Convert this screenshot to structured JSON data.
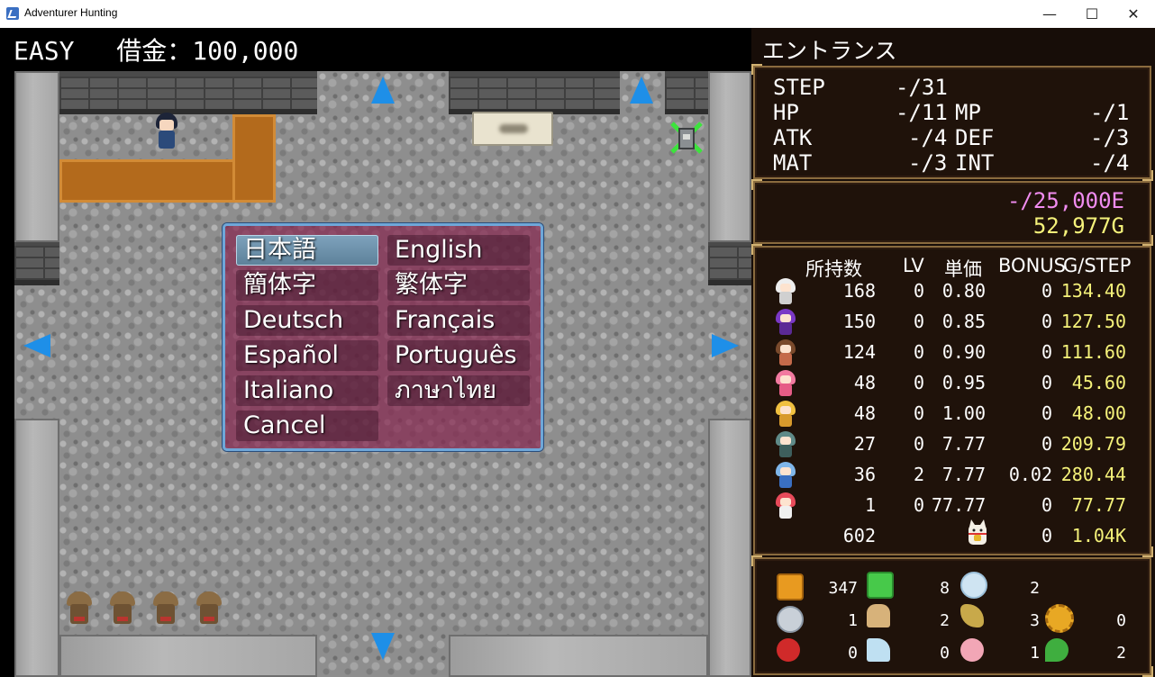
{
  "window": {
    "title": "Adventurer Hunting",
    "minimize": "—",
    "maximize": "☐",
    "close": "✕"
  },
  "hud": {
    "difficulty": "EASY",
    "debt": "借金：100,000"
  },
  "language_menu": {
    "options": [
      "日本語",
      "English",
      "簡体字",
      "繁体字",
      "Deutsch",
      "Français",
      "Español",
      "Português",
      "Italiano",
      "ภาษาไทย",
      "Cancel"
    ],
    "selected": "日本語"
  },
  "panel": {
    "location": "エントランス",
    "stats": [
      {
        "label": "STEP",
        "value": "-/31"
      },
      {
        "label": "HP",
        "value": "-/11"
      },
      {
        "label": "MP",
        "value": "-/1"
      },
      {
        "label": "ATK",
        "value": "-/4"
      },
      {
        "label": "DEF",
        "value": "-/3"
      },
      {
        "label": "MAT",
        "value": "-/3"
      },
      {
        "label": "INT",
        "value": "-/4"
      }
    ],
    "exp": "-/25,000E",
    "gold": "52,977G",
    "table_headers": [
      "所持数",
      "LV",
      "単価",
      "BONUS",
      "G/STEP"
    ],
    "rows": [
      {
        "owned": "168",
        "lv": "0",
        "price": "0.80",
        "bonus": "0",
        "gstep": "134.40"
      },
      {
        "owned": "150",
        "lv": "0",
        "price": "0.85",
        "bonus": "0",
        "gstep": "127.50"
      },
      {
        "owned": "124",
        "lv": "0",
        "price": "0.90",
        "bonus": "0",
        "gstep": "111.60"
      },
      {
        "owned": "48",
        "lv": "0",
        "price": "0.95",
        "bonus": "0",
        "gstep": "45.60"
      },
      {
        "owned": "48",
        "lv": "0",
        "price": "1.00",
        "bonus": "0",
        "gstep": "48.00"
      },
      {
        "owned": "27",
        "lv": "0",
        "price": "7.77",
        "bonus": "0",
        "gstep": "209.79"
      },
      {
        "owned": "36",
        "lv": "2",
        "price": "7.77",
        "bonus": "0.02",
        "gstep": "280.44"
      },
      {
        "owned": "1",
        "lv": "0",
        "price": "77.77",
        "bonus": "0",
        "gstep": "77.77"
      }
    ],
    "totals": {
      "owned": "602",
      "bonus": "0",
      "gstep": "1.04K"
    },
    "items": [
      {
        "icon": "gold-barrel-icon",
        "count": "347"
      },
      {
        "icon": "green-idol-icon",
        "count": "8"
      },
      {
        "icon": "crystal-icon",
        "count": "2"
      },
      {
        "icon": "silver-coin-icon",
        "count": "1"
      },
      {
        "icon": "stone-statue-icon",
        "count": "2"
      },
      {
        "icon": "root-vegetable-icon",
        "count": "3"
      },
      {
        "icon": "gear-icon",
        "count": "0"
      },
      {
        "icon": "ladybug-icon",
        "count": "0"
      },
      {
        "icon": "glass-slipper-icon",
        "count": "0"
      },
      {
        "icon": "piggy-bank-icon",
        "count": "1"
      },
      {
        "icon": "clover-icon",
        "count": "2"
      }
    ]
  },
  "colors": {
    "menu_bg": "#872850",
    "arrow": "#1e8fe8",
    "exp": "#f08cf0",
    "gold": "#f5f27a",
    "panel_border": "#8a6b3e"
  }
}
